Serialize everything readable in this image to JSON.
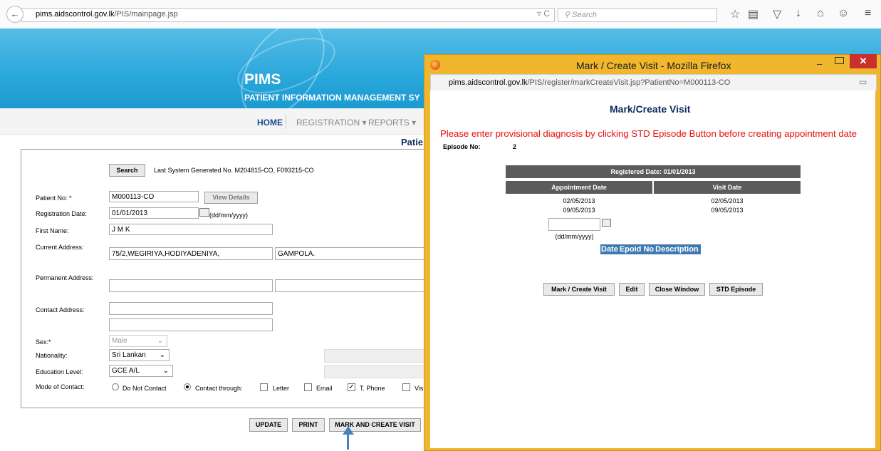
{
  "browser": {
    "url_host": "pims.aidscontrol.gov.lk",
    "url_path": "/PIS/mainpage.jsp",
    "search_placeholder": "Search"
  },
  "banner": {
    "title": "PIMS",
    "subtitle": "PATIENT INFORMATION MANAGEMENT SY"
  },
  "nav": {
    "home": "HOME",
    "registration": "REGISTRATION ▾",
    "reports": "REPORTS ▾"
  },
  "page_title": "Patie",
  "form": {
    "search_button": "Search",
    "last_generated": "Last System Generated No. M204815-CO, F093215-CO",
    "patient_no_label": "Patient No: *",
    "patient_no_value": "M000113-CO",
    "view_details_button": "View Details",
    "reg_date_label": "Registration Date:",
    "reg_date_value": "01/01/2013",
    "reg_date_hint": "(dd/mm/yyyy)",
    "first_name_label": "First Name:",
    "first_name_value": "J M K",
    "current_address_label": "Current Address:",
    "current_address_1": "75/2,WEGIRIYA,HODIYADENIYA,",
    "current_address_2": "GAMPOLA.",
    "permanent_address_label": "Permanent Address:",
    "contact_address_label": "Contact Address:",
    "sex_label": "Sex:*",
    "sex_value": "Male",
    "nationality_label": "Nationality:",
    "nationality_value": "Sri Lankan",
    "education_label": "Education Level:",
    "education_value": "GCE A/L",
    "contact_mode_label": "Mode of Contact:",
    "opt_do_not_contact": "Do Not Contact",
    "opt_contact_through": "Contact through:",
    "opt_letter": "Letter",
    "opt_email": "Email",
    "opt_phone": "T. Phone",
    "opt_visit": "Visi",
    "update_button": "UPDATE",
    "print_button": "PRINT",
    "mark_create_button": "MARK AND CREATE VISIT"
  },
  "popup": {
    "window_title": "Mark / Create Visit - Mozilla Firefox",
    "url_host": "pims.aidscontrol.gov.lk",
    "url_path": "/PIS/register/markCreateVisit.jsp?PatientNo=M000113-CO",
    "heading": "Mark/Create Visit",
    "warning": "Please enter provisional diagnosis by clicking STD Episode Button before creating appointment date",
    "episode_label": "Episode No:",
    "episode_value": "2",
    "registered_date": "Registered Date: 01/01/2013",
    "col_appointment": "Appointment Date",
    "col_visit": "Visit Date",
    "rows": [
      {
        "appointment": "02/05/2013",
        "visit": "02/05/2013"
      },
      {
        "appointment": "09/05/2013",
        "visit": "09/05/2013"
      }
    ],
    "date_hint": "(dd/mm/yyyy)",
    "episode_headers": [
      "Date",
      "Epoid No",
      "Description"
    ],
    "buttons": {
      "mark_create": "Mark / Create Visit",
      "edit": "Edit",
      "close": "Close Window",
      "std_episode": "STD Episode"
    }
  }
}
